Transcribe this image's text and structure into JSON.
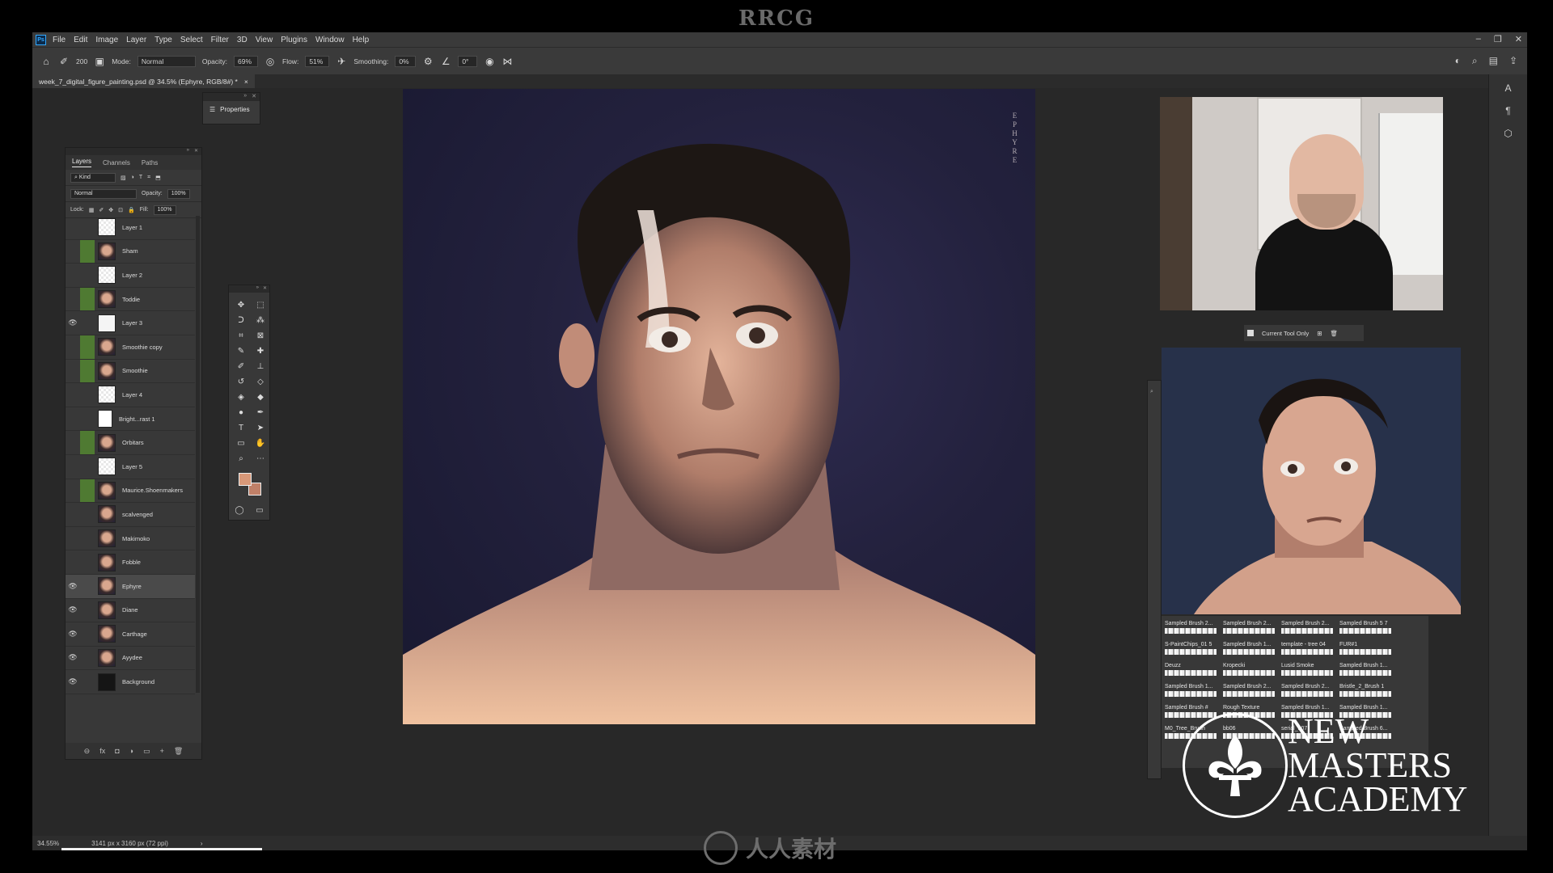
{
  "watermark": {
    "top": "RRCG",
    "bottom": "人人素材"
  },
  "menubar": {
    "logo": "Ps",
    "items": [
      "File",
      "Edit",
      "Image",
      "Layer",
      "Type",
      "Select",
      "Filter",
      "3D",
      "View",
      "Plugins",
      "Window",
      "Help"
    ]
  },
  "options": {
    "brush_size": "200",
    "mode_label": "Mode:",
    "mode_value": "Normal",
    "opacity_label": "Opacity:",
    "opacity_value": "69%",
    "flow_label": "Flow:",
    "flow_value": "51%",
    "smoothing_label": "Smoothing:",
    "smoothing_value": "0%",
    "angle_value": "0°"
  },
  "document": {
    "tab_title": "week_7_digital_figure_painting.psd @ 34.5% (Ephyre, RGB/8#) *",
    "close": "×"
  },
  "painting": {
    "vertical_title": "EPHYRE"
  },
  "properties": {
    "title": "Properties"
  },
  "layers_panel": {
    "tabs": [
      "Layers",
      "Channels",
      "Paths"
    ],
    "kind_label": "Kind",
    "blend_mode": "Normal",
    "opacity_label": "Opacity:",
    "opacity_value": "100%",
    "lock_label": "Lock:",
    "fill_label": "Fill:",
    "fill_value": "100%",
    "layers": [
      {
        "name": "Layer 1",
        "visible": false,
        "tag": "",
        "thumb": "checker"
      },
      {
        "name": "Sham",
        "visible": false,
        "tag": "green",
        "thumb": "face"
      },
      {
        "name": "Layer 2",
        "visible": false,
        "tag": "",
        "thumb": "checker"
      },
      {
        "name": "Toddie",
        "visible": false,
        "tag": "green",
        "thumb": "face"
      },
      {
        "name": "Layer 3",
        "visible": true,
        "tag": "",
        "thumb": "blank"
      },
      {
        "name": "Smoothie copy",
        "visible": false,
        "tag": "green",
        "thumb": "face"
      },
      {
        "name": "Smoothie",
        "visible": false,
        "tag": "green",
        "thumb": "face"
      },
      {
        "name": "Layer 4",
        "visible": false,
        "tag": "",
        "thumb": "checker"
      },
      {
        "name": "Bright...rast 1",
        "visible": false,
        "tag": "",
        "thumb": "adj"
      },
      {
        "name": "Orbitars",
        "visible": false,
        "tag": "green",
        "thumb": "face"
      },
      {
        "name": "Layer 5",
        "visible": false,
        "tag": "",
        "thumb": "checker"
      },
      {
        "name": "Maurice.Shoenmakers",
        "visible": false,
        "tag": "green",
        "thumb": "face"
      },
      {
        "name": "scalvenged",
        "visible": false,
        "tag": "",
        "thumb": "face"
      },
      {
        "name": "Makimoko",
        "visible": false,
        "tag": "",
        "thumb": "face"
      },
      {
        "name": "Fobble",
        "visible": false,
        "tag": "",
        "thumb": "face"
      },
      {
        "name": "Ephyre",
        "visible": true,
        "tag": "",
        "thumb": "face",
        "selected": true
      },
      {
        "name": "Diane",
        "visible": true,
        "tag": "",
        "thumb": "face"
      },
      {
        "name": "Carthage",
        "visible": true,
        "tag": "",
        "thumb": "face"
      },
      {
        "name": "Ayydee",
        "visible": true,
        "tag": "",
        "thumb": "face"
      },
      {
        "name": "Background",
        "visible": true,
        "tag": "",
        "thumb": "dark"
      }
    ],
    "footer_icons": [
      "link-icon",
      "fx-icon",
      "mask-icon",
      "adjustment-icon",
      "folder-icon",
      "new-layer-icon",
      "trash-icon"
    ],
    "footer_glyphs": [
      "⊖",
      "fx",
      "◘",
      "◑",
      "▭",
      "+",
      "🗑"
    ]
  },
  "tools": {
    "items": [
      {
        "name": "move-tool-icon",
        "glyph": "✥"
      },
      {
        "name": "marquee-tool-icon",
        "glyph": "⬚"
      },
      {
        "name": "lasso-tool-icon",
        "glyph": "ᑐ"
      },
      {
        "name": "magic-wand-tool-icon",
        "glyph": "⁂"
      },
      {
        "name": "crop-tool-icon",
        "glyph": "⌗"
      },
      {
        "name": "frame-tool-icon",
        "glyph": "⊠"
      },
      {
        "name": "eyedropper-tool-icon",
        "glyph": "✎"
      },
      {
        "name": "healing-tool-icon",
        "glyph": "✚"
      },
      {
        "name": "brush-tool-icon",
        "glyph": "✐"
      },
      {
        "name": "stamp-tool-icon",
        "glyph": "⊥"
      },
      {
        "name": "history-brush-tool-icon",
        "glyph": "↺"
      },
      {
        "name": "eraser-tool-icon",
        "glyph": "◇"
      },
      {
        "name": "paint-bucket-tool-icon",
        "glyph": "◈"
      },
      {
        "name": "blur-tool-icon",
        "glyph": "◆"
      },
      {
        "name": "dodge-tool-icon",
        "glyph": "●"
      },
      {
        "name": "pen-tool-icon",
        "glyph": "✒"
      },
      {
        "name": "type-tool-icon",
        "glyph": "T"
      },
      {
        "name": "path-select-tool-icon",
        "glyph": "➤"
      },
      {
        "name": "shape-tool-icon",
        "glyph": "▭"
      },
      {
        "name": "hand-tool-icon",
        "glyph": "✋"
      },
      {
        "name": "zoom-tool-icon",
        "glyph": "⌕"
      },
      {
        "name": "more-tools-icon",
        "glyph": "⋯"
      }
    ],
    "fg_color": "#d89878",
    "bg_color": "#c08068"
  },
  "tool_options": {
    "checkbox_label": "Current Tool Only"
  },
  "brushes": [
    {
      "label": "Sampled Brush 2..."
    },
    {
      "label": "Sampled Brush 2..."
    },
    {
      "label": "Sampled Brush 2..."
    },
    {
      "label": "Sampled Brush 5 7"
    },
    {
      "label": "S-PaintChips_01 5"
    },
    {
      "label": "Sampled Brush 1..."
    },
    {
      "label": "template - tree 04"
    },
    {
      "label": "FUR#1"
    },
    {
      "label": "Deuzz"
    },
    {
      "label": "Kropecki"
    },
    {
      "label": "Lusid Smoke"
    },
    {
      "label": "Sampled Brush 1..."
    },
    {
      "label": "Sampled Brush 1..."
    },
    {
      "label": "Sampled Brush 2..."
    },
    {
      "label": "Sampled Brush 2..."
    },
    {
      "label": "Bristle_2_Brush 1"
    },
    {
      "label": "Sampled Brush #"
    },
    {
      "label": "Rough Texture"
    },
    {
      "label": "Sampled Brush 1..."
    },
    {
      "label": "Sampled Brush 1..."
    },
    {
      "label": "M0_Tree_Brush"
    },
    {
      "label": "bb06"
    },
    {
      "label": "serial_a07"
    },
    {
      "label": "Sampled Brush 6..."
    }
  ],
  "status": {
    "zoom": "34.55%",
    "doc_info": "3141 px x 3160 px (72 ppi)",
    "arrow": "›"
  },
  "branding": {
    "line1": "NEW",
    "line2": "MASTERS",
    "line3": "ACADEMY"
  },
  "colors": {
    "accent": "#31a8ff",
    "layer_tag_green": "#4f7a32",
    "panel": "#383838",
    "canvas_bg": "#282828"
  }
}
